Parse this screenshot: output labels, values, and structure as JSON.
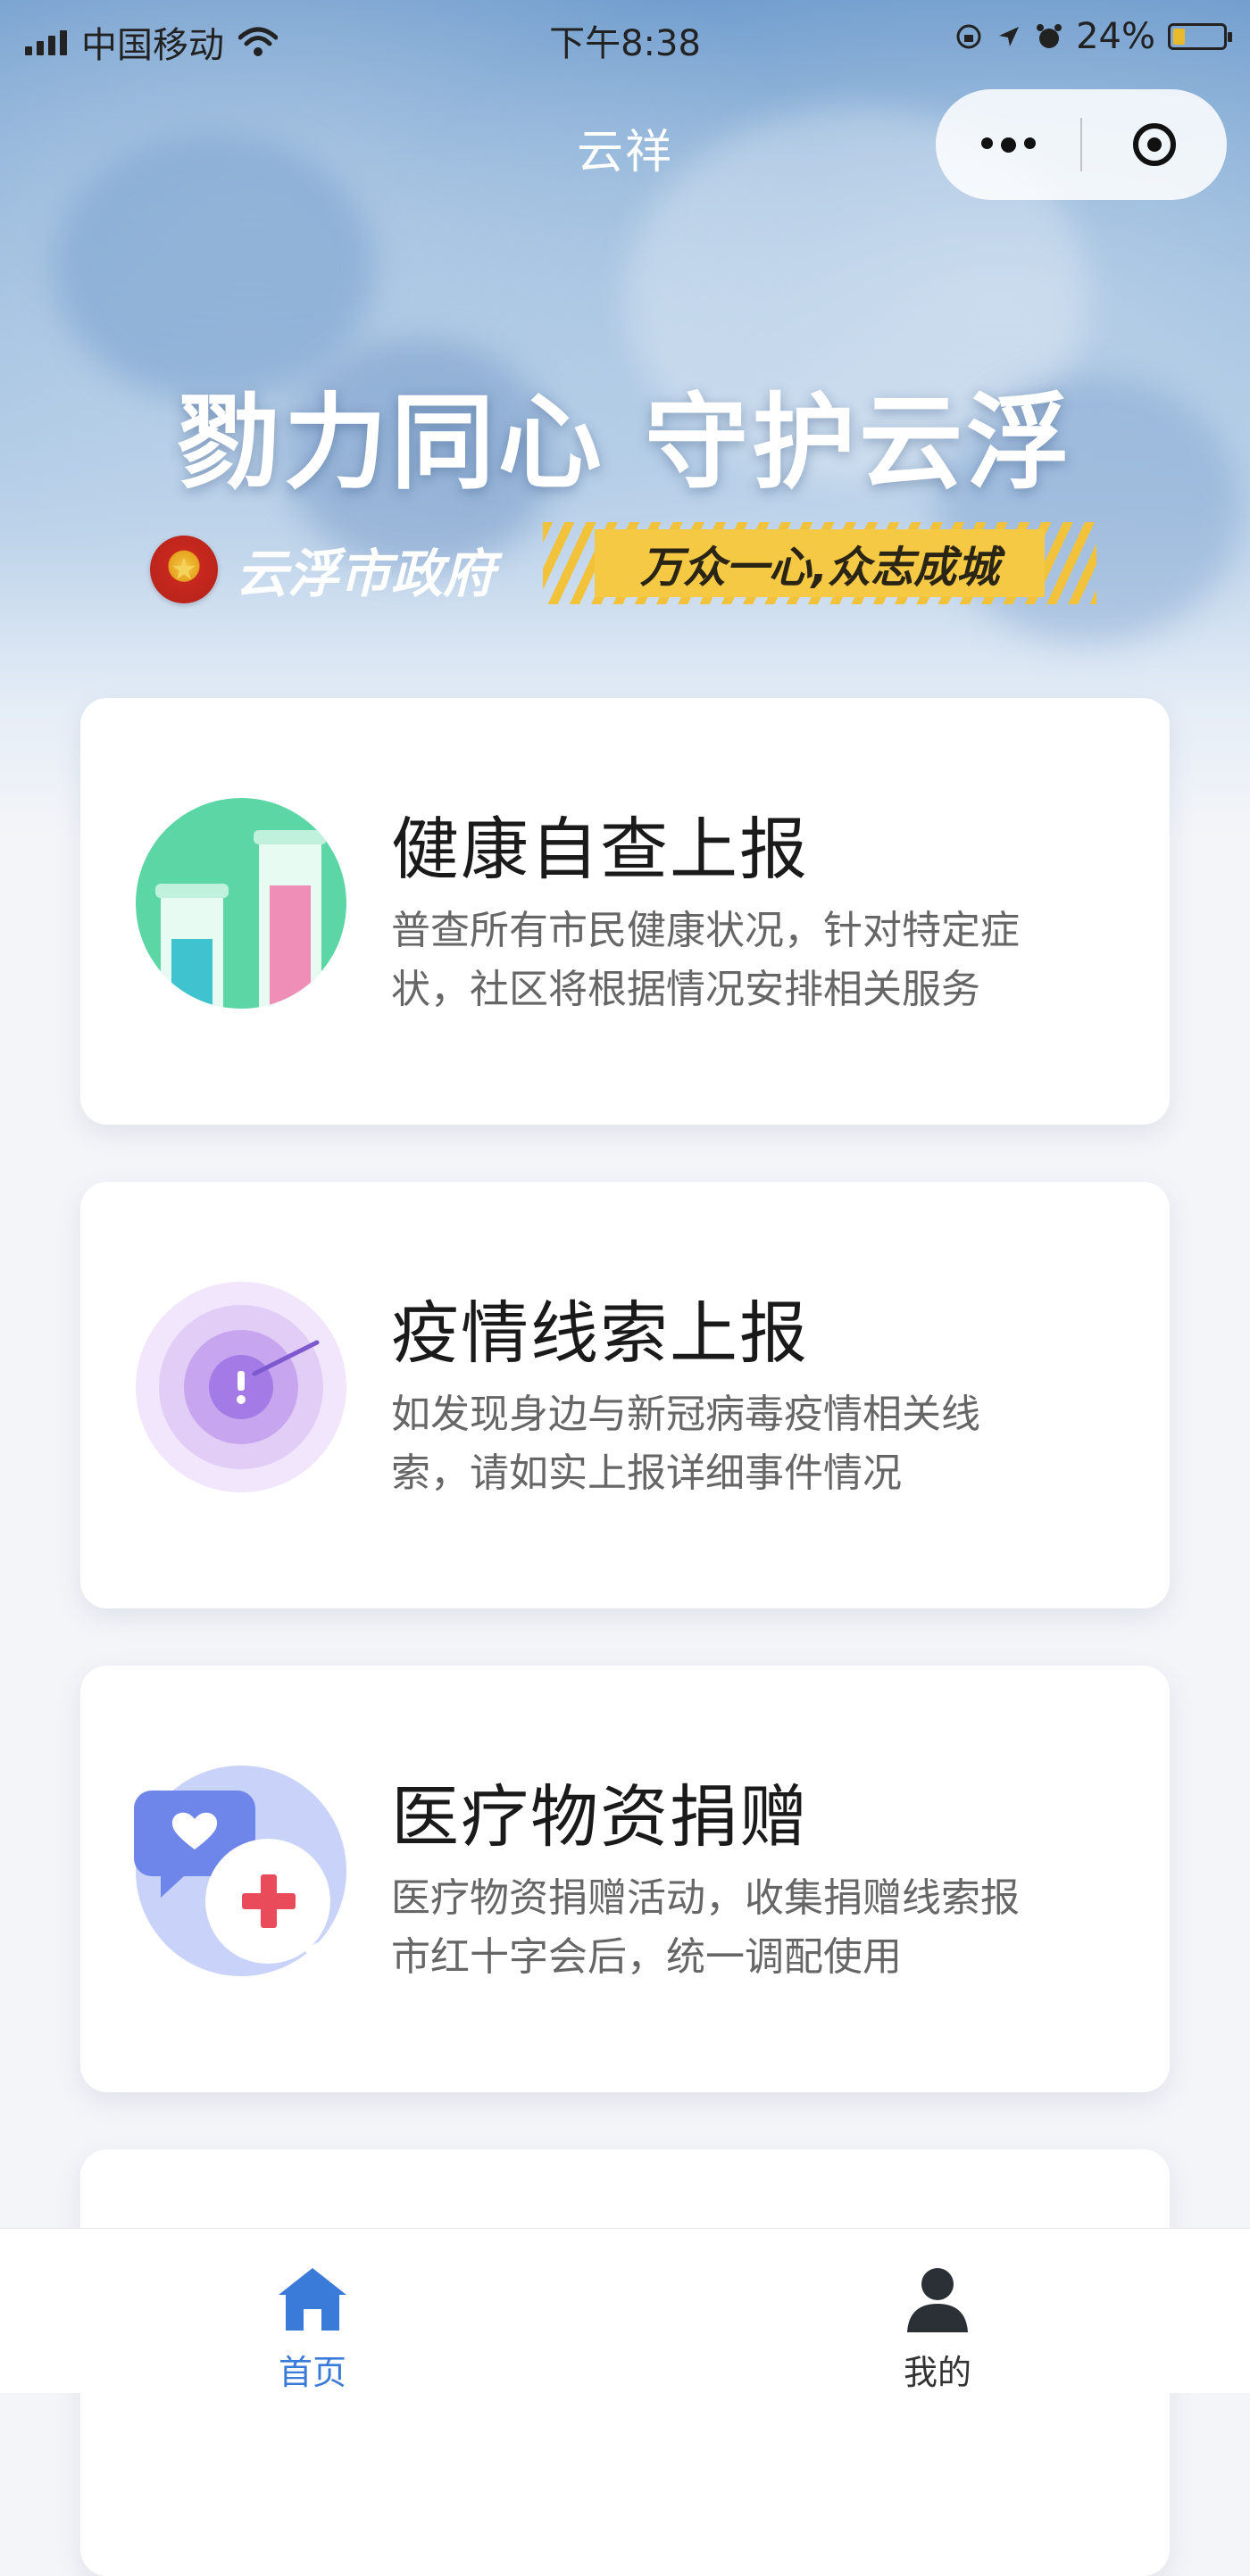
{
  "status_bar": {
    "carrier": "中国移动",
    "time": "下午8:38",
    "battery": "24%",
    "battery_level": 0.24
  },
  "nav": {
    "title": "云祥"
  },
  "hero": {
    "headline": "勠力同心 守护云浮",
    "government": "云浮市政府",
    "slogan": "万众一心,众志成城"
  },
  "cards": [
    {
      "title": "健康自查上报",
      "desc_line1": "普查所有市民健康状况，针对特定症",
      "desc_line2": "状，社区将根据情况安排相关服务",
      "icon": "test-tubes-icon"
    },
    {
      "title": "疫情线索上报",
      "desc_line1": "如发现身边与新冠病毒疫情相关线",
      "desc_line2": "索，请如实上报详细事件情况",
      "icon": "radar-alert-icon"
    },
    {
      "title": "医疗物资捐赠",
      "desc_line1": "医疗物资捐赠活动，收集捐赠线索报",
      "desc_line2": "市红十字会后，统一调配使用",
      "icon": "donation-chat-icon"
    }
  ],
  "tabbar": {
    "home_label": "首页",
    "mine_label": "我的"
  },
  "colors": {
    "accent": "#3a7bd9",
    "slogan_bg": "#f6c944",
    "card_green": "#5dd6a6",
    "card_purple": "#a47be6",
    "card_blue": "#6e86ea",
    "cross_red": "#e94b5b"
  }
}
